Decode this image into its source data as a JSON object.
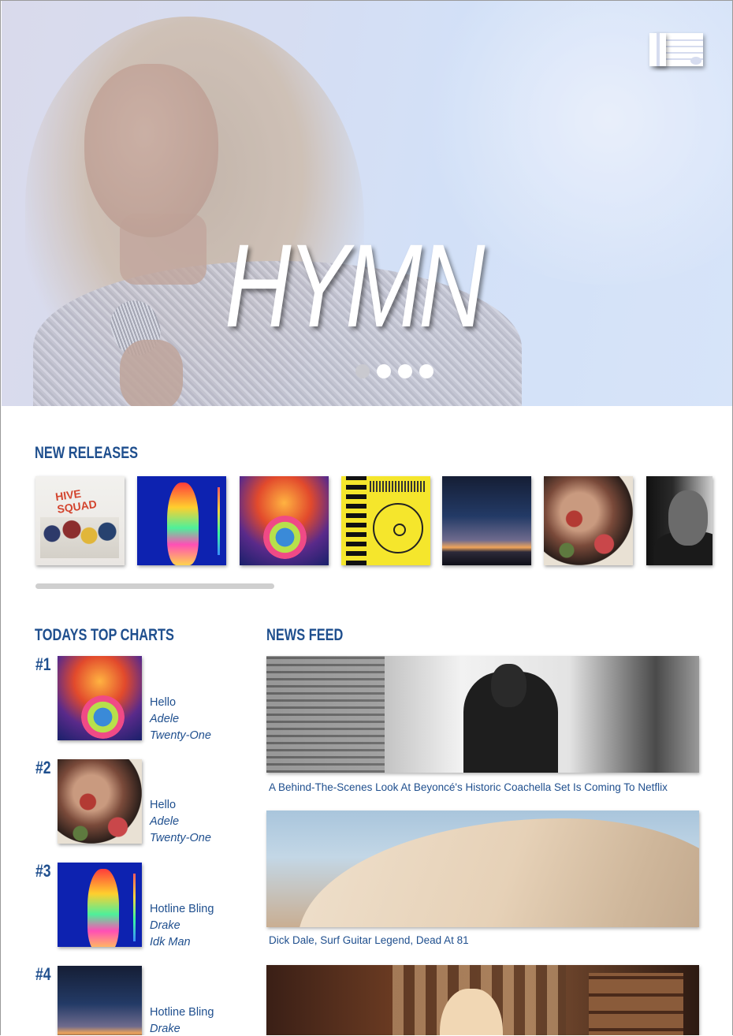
{
  "brand": {
    "title": "HYMN",
    "logo_icon": "hymn-logo-icon"
  },
  "hero": {
    "carousel_dots": 4,
    "active_dot": 0
  },
  "new_releases": {
    "heading": "NEW RELEASES",
    "albums": [
      {
        "name": "album-1",
        "cover_text": "HIVE SQUAD"
      },
      {
        "name": "album-2"
      },
      {
        "name": "album-3"
      },
      {
        "name": "album-4"
      },
      {
        "name": "album-5"
      },
      {
        "name": "album-6"
      },
      {
        "name": "album-7"
      }
    ]
  },
  "top_charts": {
    "heading": "TODAYS TOP CHARTS",
    "items": [
      {
        "rank": "#1",
        "song": "Hello",
        "artist": "Adele",
        "album": "Twenty-One"
      },
      {
        "rank": "#2",
        "song": "Hello",
        "artist": "Adele",
        "album": "Twenty-One"
      },
      {
        "rank": "#3",
        "song": "Hotline Bling",
        "artist": "Drake",
        "album": "Idk Man"
      },
      {
        "rank": "#4",
        "song": "Hotline Bling",
        "artist": "Drake",
        "album": ""
      }
    ]
  },
  "news_feed": {
    "heading": "NEWS FEED",
    "items": [
      {
        "caption": "A Behind-The-Scenes Look At Beyoncé's Historic Coachella Set Is Coming To Netflix"
      },
      {
        "caption": "Dick Dale, Surf Guitar Legend, Dead At 81"
      },
      {
        "caption": ""
      }
    ]
  },
  "colors": {
    "accent": "#1f4f8e",
    "background": "#ffffff"
  }
}
